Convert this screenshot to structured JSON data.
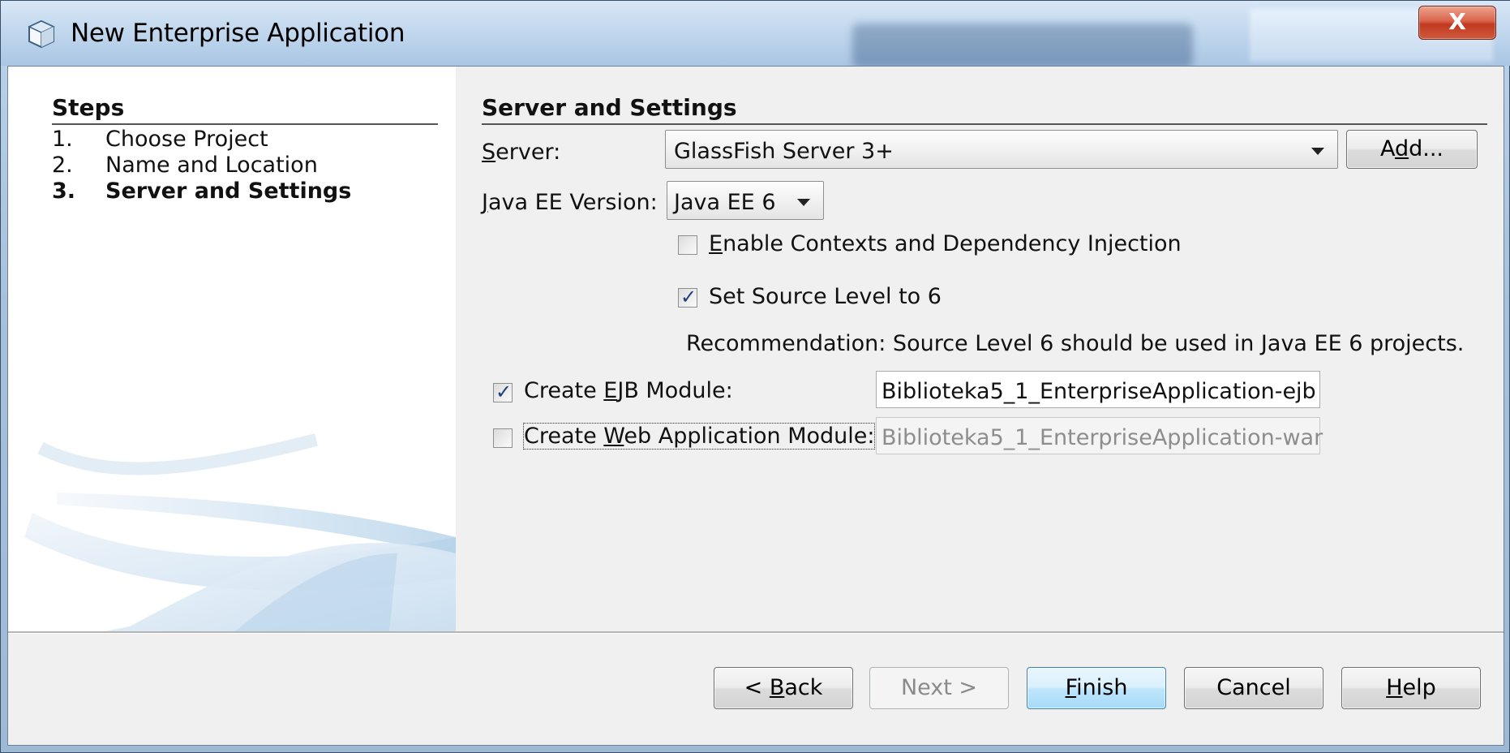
{
  "window": {
    "title": "New Enterprise Application",
    "close_label": "X"
  },
  "steps": {
    "heading": "Steps",
    "items": [
      {
        "num": "1.",
        "label": "Choose Project",
        "current": false
      },
      {
        "num": "2.",
        "label": "Name and Location",
        "current": false
      },
      {
        "num": "3.",
        "label": "Server and Settings",
        "current": true
      }
    ]
  },
  "settings": {
    "heading": "Server and Settings",
    "server": {
      "label_pre": "",
      "label_mnemonic": "S",
      "label_post": "erver:",
      "selected": "GlassFish Server 3+",
      "add_pre": "A",
      "add_mnemonic": "d",
      "add_post": "d..."
    },
    "javaee": {
      "label_mnemonic": "J",
      "label_post": "ava EE Version:",
      "selected": "Java EE 6"
    },
    "cdi": {
      "checked": false,
      "label_mnemonic": "E",
      "label_post": "nable Contexts and Dependency Injection"
    },
    "source_level": {
      "checked": true,
      "label": "Set Source Level to 6"
    },
    "recommendation": "Recommendation: Source Level 6 should be used in Java EE 6 projects.",
    "ejb": {
      "checked": true,
      "label_pre": "Create ",
      "label_mnemonic": "E",
      "label_post": "JB Module:",
      "value": "Biblioteka5_1_EnterpriseApplication-ejb"
    },
    "web": {
      "checked": false,
      "label_pre": "Create ",
      "label_mnemonic": "W",
      "label_post": "eb Application Module:",
      "value": "Biblioteka5_1_EnterpriseApplication-war"
    }
  },
  "buttons": {
    "back_pre": "< ",
    "back_mnemonic": "B",
    "back_post": "ack",
    "next": "Next >",
    "finish_mnemonic": "F",
    "finish_post": "inish",
    "cancel": "Cancel",
    "help_mnemonic": "H",
    "help_post": "elp"
  }
}
